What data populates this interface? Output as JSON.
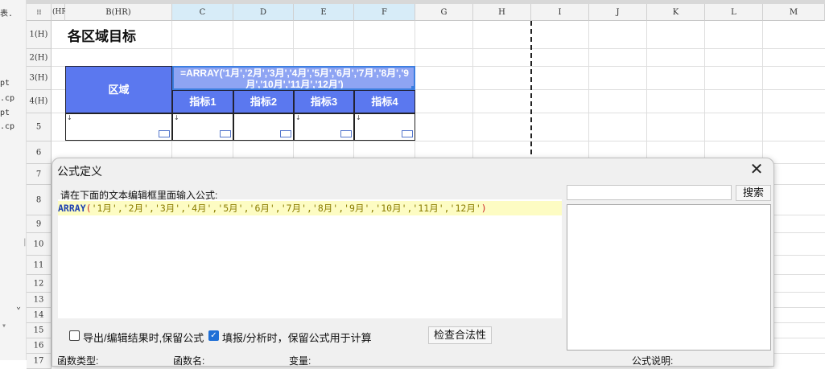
{
  "left_strip": {
    "lines": [
      "表.",
      "pt",
      ".cp",
      "pt",
      ".cp"
    ]
  },
  "columns": [
    {
      "label": "(HR)"
    },
    {
      "label": "B(HR)"
    },
    {
      "label": "C"
    },
    {
      "label": "D"
    },
    {
      "label": "E"
    },
    {
      "label": "F"
    },
    {
      "label": "G"
    },
    {
      "label": "H"
    },
    {
      "label": "I"
    },
    {
      "label": "J"
    },
    {
      "label": "K"
    },
    {
      "label": "L"
    },
    {
      "label": "M"
    }
  ],
  "rows": [
    "1(H)",
    "2(H)",
    "3(H)",
    "4(H)",
    "5",
    "6",
    "7",
    "8",
    "9",
    "10",
    "11",
    "12",
    "13",
    "14",
    "15",
    "16",
    "17"
  ],
  "sheet": {
    "title": "各区域目标",
    "region_header": "区域",
    "formula_cell": "=ARRAY('1月','2月','3月','4月','5月','6月','7月','8月','9月','10月','11月','12月')",
    "indicators": [
      "指标1",
      "指标2",
      "指标3",
      "指标4"
    ],
    "colors": {
      "header_blue": "#5b78ef",
      "selected_col_header": "#d7ecf8",
      "selection_border": "#3d7fe0"
    }
  },
  "dialog": {
    "title": "公式定义",
    "close_icon": "close-icon",
    "instruction": "请在下面的文本编辑框里面输入公式:",
    "formula_tokens": [
      {
        "t": "ARRAY",
        "c": "#1c3fb0",
        "b": true
      },
      {
        "t": "(",
        "c": "#cc2a2a",
        "b": false
      },
      {
        "t": "'1月','2月','3月','4月','5月','6月','7月','8月','9月','10月','11月','12月'",
        "c": "#8a7c00",
        "b": false
      },
      {
        "t": ")",
        "c": "#cc2a2a",
        "b": false
      }
    ],
    "search_placeholder": "",
    "search_button": "搜索",
    "checkbox1": {
      "label": "导出/编辑结果时,保留公式",
      "checked": false
    },
    "checkbox2": {
      "label": "填报/分析时，保留公式用于计算",
      "checked": true
    },
    "check_button": "检查合法性",
    "bottom_labels": [
      "函数类型:",
      "函数名:",
      "变量:",
      "公式说明:"
    ]
  }
}
